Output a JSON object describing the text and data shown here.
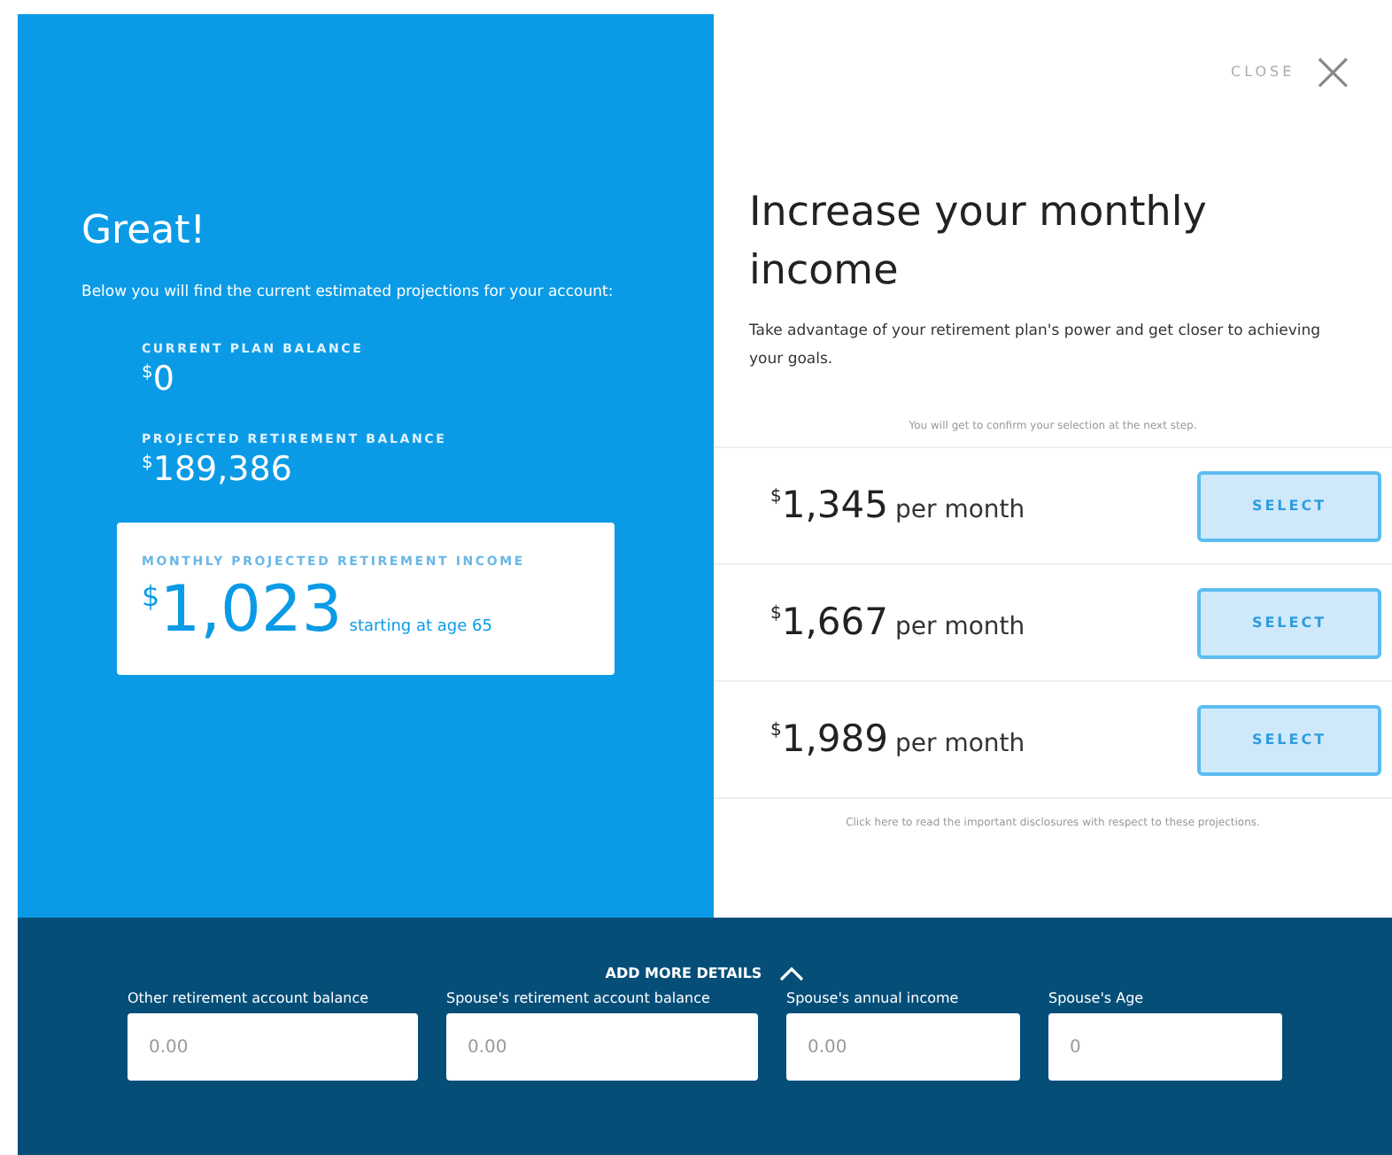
{
  "summary": {
    "title": "Great!",
    "intro": "Below you will find the current estimated projections for your account:",
    "balances": [
      {
        "label": "CURRENT PLAN BALANCE",
        "currency": "$",
        "amount": "0"
      },
      {
        "label": "PROJECTED RETIREMENT BALANCE",
        "currency": "$",
        "amount": "189,386"
      }
    ],
    "income": {
      "label": "MONTHLY PROJECTED RETIREMENT INCOME",
      "currency": "$",
      "amount": "1,023",
      "note": "starting at age 65"
    }
  },
  "close": {
    "label": "CLOSE",
    "icon": "×"
  },
  "options": {
    "title": "Increase your monthly income",
    "intro": "Take advantage of your retirement plan's power and get closer to achieving your goals.",
    "hint": "You will get to confirm your selection at the next step.",
    "items": [
      {
        "currency": "$",
        "amount": "1,345",
        "unit": "per month",
        "button": "SELECT"
      },
      {
        "currency": "$",
        "amount": "1,667",
        "unit": "per month",
        "button": "SELECT"
      },
      {
        "currency": "$",
        "amount": "1,989",
        "unit": "per month",
        "button": "SELECT"
      }
    ],
    "disclosure": "Click here to read the important disclosures with respect to these projections."
  },
  "details": {
    "toggle": "ADD MORE DETAILS",
    "expanded": true,
    "fields": [
      {
        "label": "Other retirement account balance",
        "placeholder": "0.00"
      },
      {
        "label": "Spouse's retirement account balance",
        "placeholder": "0.00"
      },
      {
        "label": "Spouse's annual income",
        "placeholder": "0.00"
      },
      {
        "label": "Spouse's Age",
        "placeholder": "0"
      }
    ]
  }
}
